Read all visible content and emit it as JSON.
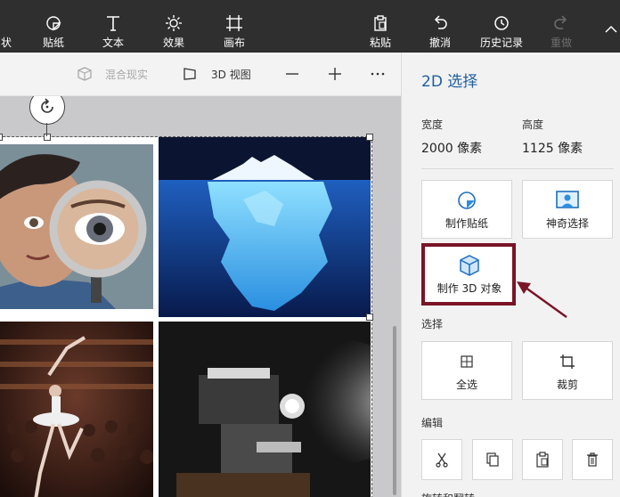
{
  "toolbar": {
    "shapes_label": "状",
    "stickers_label": "贴纸",
    "text_label": "文本",
    "effects_label": "效果",
    "canvas_label": "画布",
    "paste_label": "粘贴",
    "undo_label": "撤消",
    "history_label": "历史记录",
    "redo_label": "重做"
  },
  "subbar": {
    "mixed_reality_label": "混合现实",
    "view3d_label": "3D 视图"
  },
  "panel": {
    "title": "2D 选择",
    "width_label": "宽度",
    "width_value": "2000 像素",
    "height_label": "高度",
    "height_value": "1125 像素",
    "make_sticker_label": "制作贴纸",
    "magic_select_label": "神奇选择",
    "make_3d_label": "制作 3D 对象",
    "select_section": "选择",
    "select_all_label": "全选",
    "crop_label": "裁剪",
    "edit_section": "编辑",
    "bottom_cut_text": "旋转和翻转"
  },
  "colors": {
    "topbar": "#2f2f2f",
    "accent_title": "#1f5f9e",
    "highlight": "#7a1426"
  }
}
